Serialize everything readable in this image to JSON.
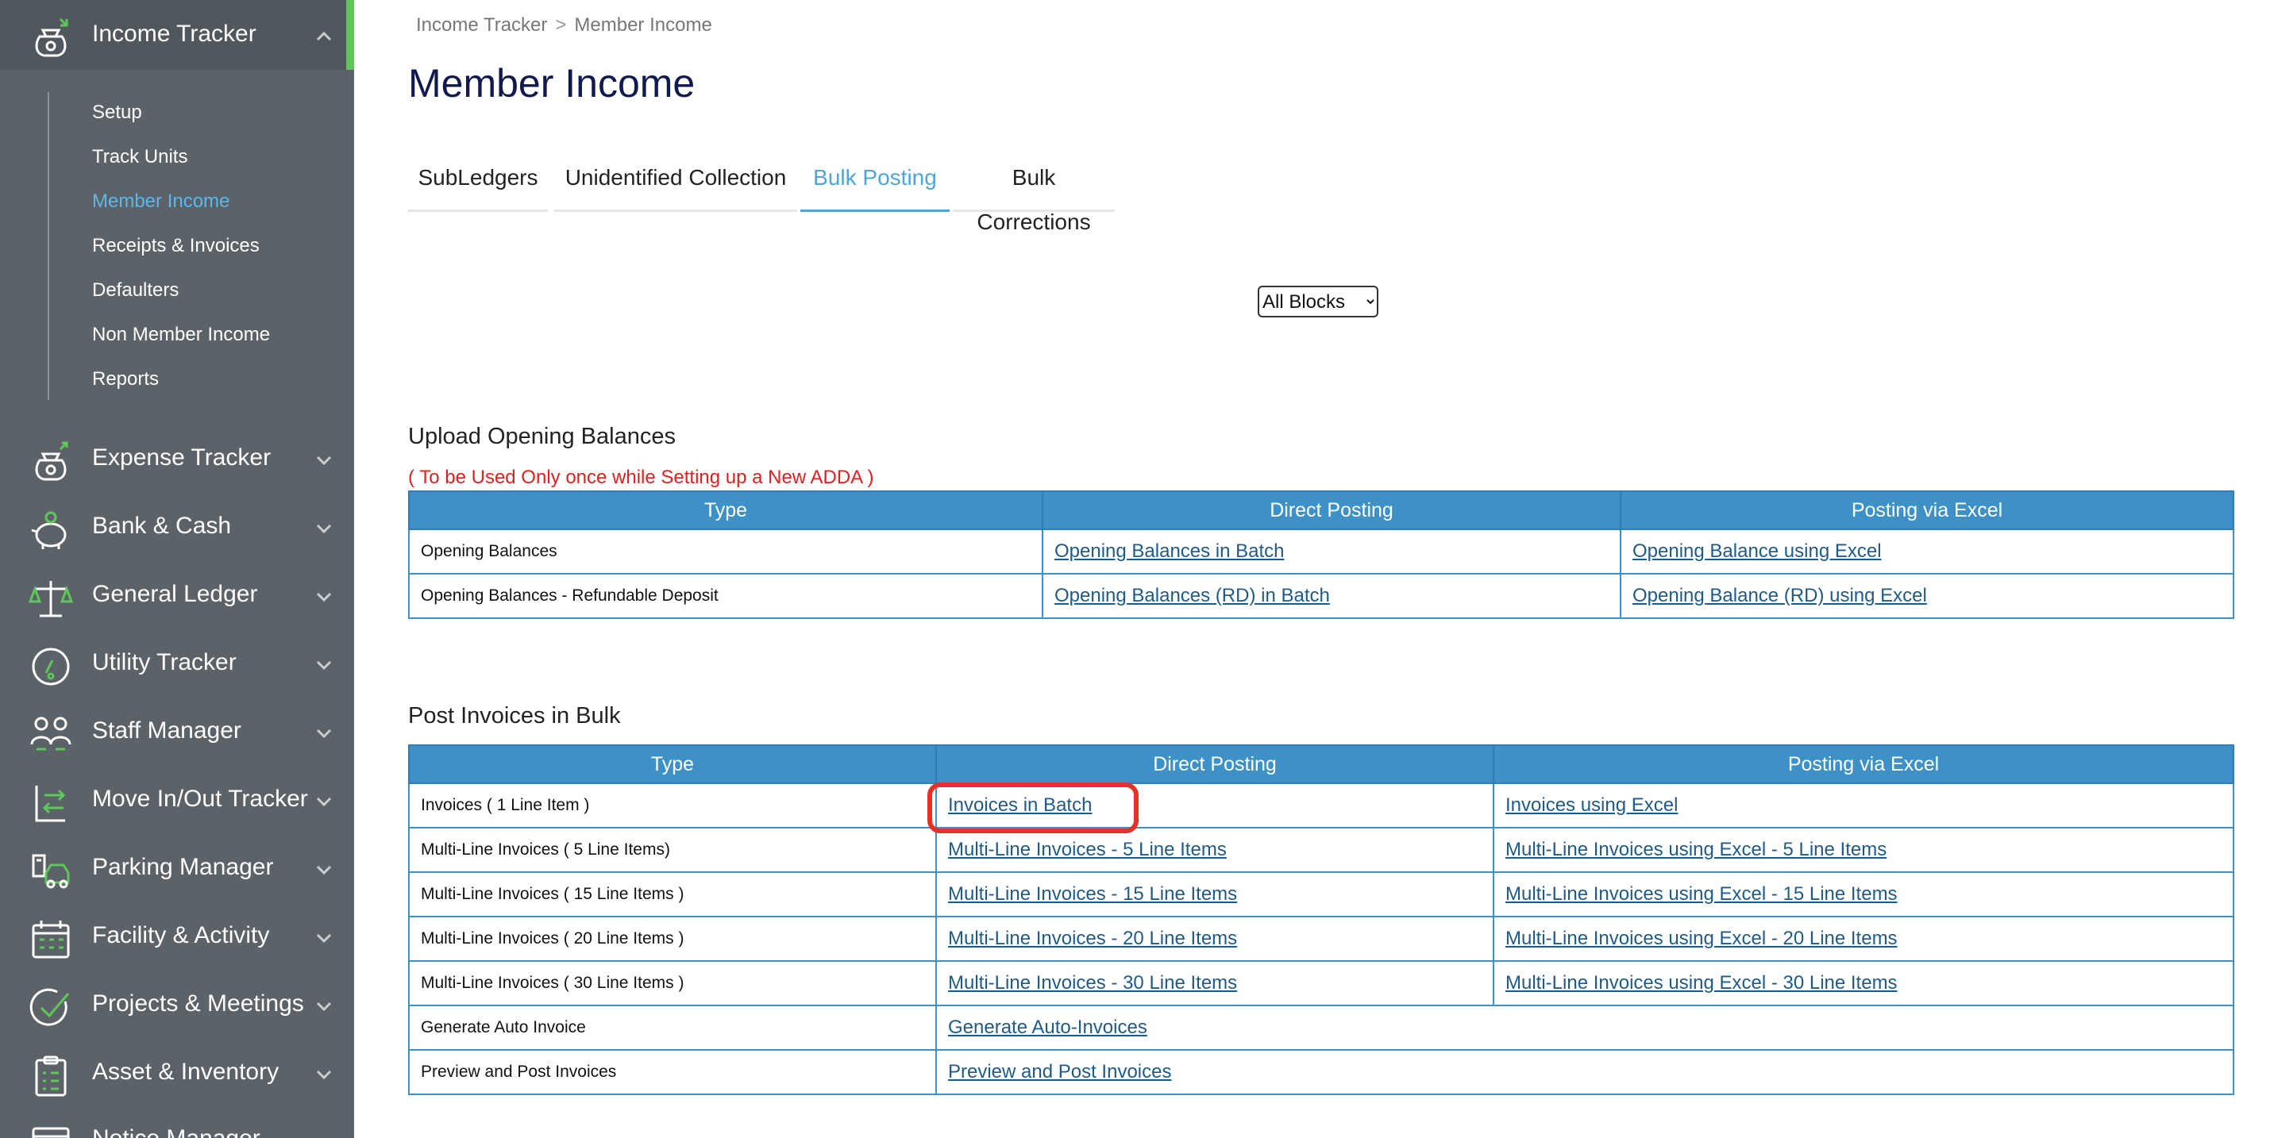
{
  "sidebar": {
    "header": {
      "label": "Income Tracker"
    },
    "submenu": [
      {
        "label": "Setup"
      },
      {
        "label": "Track Units"
      },
      {
        "label": "Member Income",
        "active": true
      },
      {
        "label": "Receipts & Invoices"
      },
      {
        "label": "Defaulters"
      },
      {
        "label": "Non Member Income"
      },
      {
        "label": "Reports"
      }
    ],
    "modules": [
      {
        "label": "Expense Tracker",
        "icon": "expense-icon"
      },
      {
        "label": "Bank & Cash",
        "icon": "piggy-bank-icon"
      },
      {
        "label": "General Ledger",
        "icon": "balance-scale-icon"
      },
      {
        "label": "Utility Tracker",
        "icon": "gauge-icon"
      },
      {
        "label": "Staff Manager",
        "icon": "staff-icon"
      },
      {
        "label": "Move In/Out Tracker",
        "icon": "move-in-out-icon"
      },
      {
        "label": "Parking Manager",
        "icon": "car-icon"
      },
      {
        "label": "Facility & Activity",
        "icon": "calendar-icon"
      },
      {
        "label": "Projects & Meetings",
        "icon": "check-circle-icon"
      },
      {
        "label": "Asset & Inventory",
        "icon": "clipboard-icon"
      },
      {
        "label": "Notice Manager",
        "icon": "notice-icon"
      }
    ],
    "colors": {
      "bg": "#5b6268",
      "active_text": "#5db7e8",
      "accent": "#5ec65a"
    }
  },
  "breadcrumb": {
    "items": [
      "Income Tracker",
      "Member Income"
    ],
    "separator": ">"
  },
  "page": {
    "title": "Member Income"
  },
  "tabs": [
    {
      "label": "SubLedgers"
    },
    {
      "label": "Unidentified Collection"
    },
    {
      "label": "Bulk Posting",
      "active": true
    },
    {
      "label": "Bulk Corrections"
    }
  ],
  "block_filter": {
    "selected": "All Blocks"
  },
  "opening_balances": {
    "title": "Upload Opening Balances",
    "warning": "( To be Used Only once while Setting up a New ADDA )",
    "headers": [
      "Type",
      "Direct Posting",
      "Posting via Excel"
    ],
    "rows": [
      {
        "type": "Opening Balances",
        "direct": "Opening Balances in Batch",
        "excel": "Opening Balance using Excel"
      },
      {
        "type": "Opening Balances - Refundable Deposit",
        "direct": "Opening Balances (RD) in Batch",
        "excel": "Opening Balance (RD) using Excel"
      }
    ]
  },
  "bulk_invoices": {
    "title": "Post Invoices in Bulk",
    "headers": [
      "Type",
      "Direct Posting",
      "Posting via Excel"
    ],
    "rows": [
      {
        "type": "Invoices ( 1 Line Item )",
        "direct": "Invoices in Batch",
        "excel": "Invoices using Excel",
        "highlighted": true
      },
      {
        "type": "Multi-Line Invoices ( 5 Line Items)",
        "direct": "Multi-Line Invoices - 5 Line Items",
        "excel": "Multi-Line Invoices using Excel - 5 Line Items"
      },
      {
        "type": "Multi-Line Invoices ( 15 Line Items )",
        "direct": "Multi-Line Invoices - 15 Line Items",
        "excel": "Multi-Line Invoices using Excel - 15 Line Items"
      },
      {
        "type": "Multi-Line Invoices ( 20 Line Items )",
        "direct": "Multi-Line Invoices - 20 Line Items",
        "excel": "Multi-Line Invoices using Excel - 20 Line Items"
      },
      {
        "type": "Multi-Line Invoices ( 30 Line Items )",
        "direct": "Multi-Line Invoices - 30 Line Items",
        "excel": "Multi-Line Invoices using Excel - 30 Line Items"
      },
      {
        "type": "Generate Auto Invoice",
        "direct": "Generate Auto-Invoices",
        "excel": ""
      },
      {
        "type": "Preview and Post Invoices",
        "direct": "Preview and Post Invoices",
        "excel": ""
      }
    ]
  },
  "colors": {
    "table_header": "#3d91c6",
    "link": "#1f5b8a",
    "title": "#101a4e",
    "warning": "#e02020",
    "highlight": "#e53127"
  }
}
